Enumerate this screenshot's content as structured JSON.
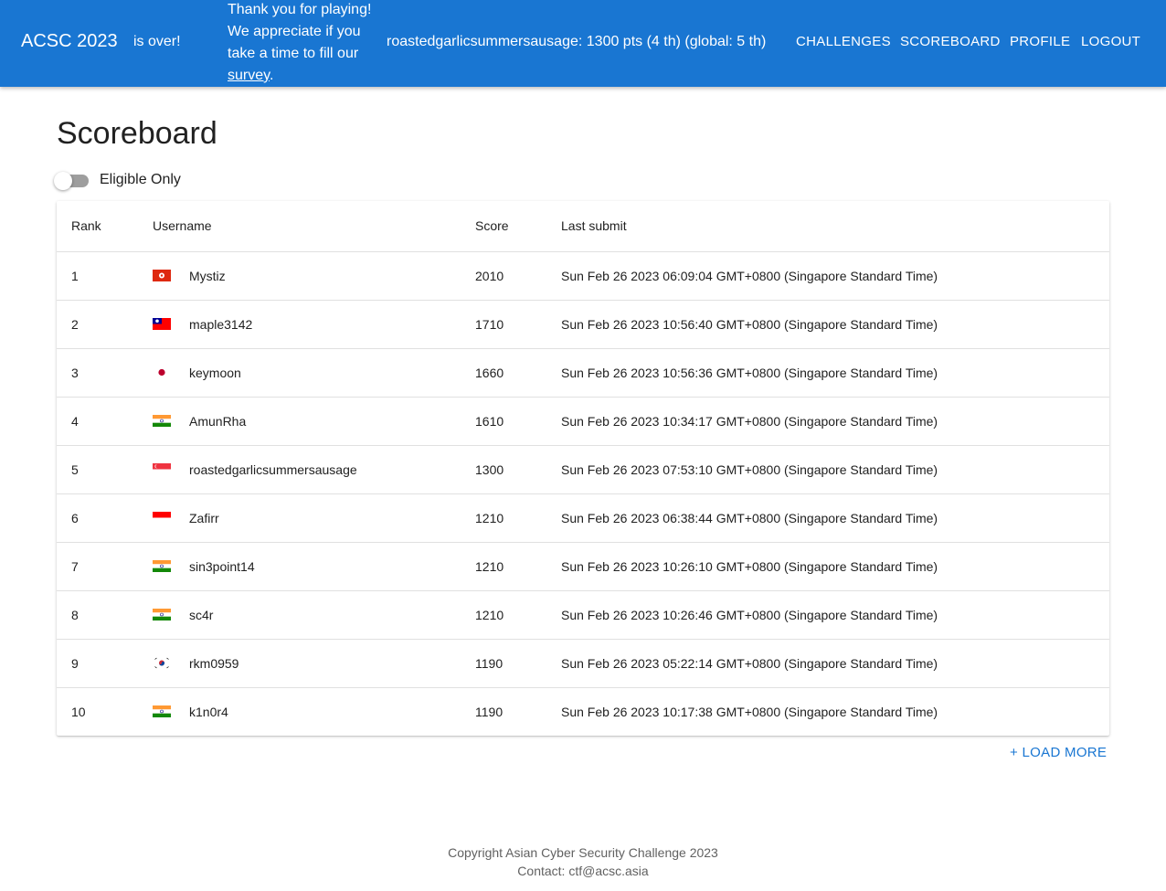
{
  "header": {
    "brand": "ACSC 2023",
    "status": "is over!",
    "thanks_text": "Thank you for playing! We appreciate if you take a time to fill our",
    "survey_link": "survey",
    "thanks_suffix": ".",
    "user_info": "roastedgarlicsummersausage: 1300 pts (4 th) (global: 5 th)",
    "nav": [
      "CHALLENGES",
      "SCOREBOARD",
      "PROFILE",
      "LOGOUT"
    ]
  },
  "page": {
    "title": "Scoreboard",
    "toggle_label": "Eligible Only",
    "toggle_on": false
  },
  "table": {
    "headers": [
      "Rank",
      "Username",
      "Score",
      "Last submit"
    ],
    "rows": [
      {
        "rank": "1",
        "flag": "hk-flag-icon",
        "username": "Mystiz",
        "score": "2010",
        "last": "Sun Feb 26 2023 06:09:04 GMT+0800 (Singapore Standard Time)"
      },
      {
        "rank": "2",
        "flag": "tw-flag-icon",
        "username": "maple3142",
        "score": "1710",
        "last": "Sun Feb 26 2023 10:56:40 GMT+0800 (Singapore Standard Time)"
      },
      {
        "rank": "3",
        "flag": "jp-flag-icon",
        "username": "keymoon",
        "score": "1660",
        "last": "Sun Feb 26 2023 10:56:36 GMT+0800 (Singapore Standard Time)"
      },
      {
        "rank": "4",
        "flag": "in-flag-icon",
        "username": "AmunRha",
        "score": "1610",
        "last": "Sun Feb 26 2023 10:34:17 GMT+0800 (Singapore Standard Time)"
      },
      {
        "rank": "5",
        "flag": "sg-flag-icon",
        "username": "roastedgarlicsummersausage",
        "score": "1300",
        "last": "Sun Feb 26 2023 07:53:10 GMT+0800 (Singapore Standard Time)"
      },
      {
        "rank": "6",
        "flag": "id-flag-icon",
        "username": "Zafirr",
        "score": "1210",
        "last": "Sun Feb 26 2023 06:38:44 GMT+0800 (Singapore Standard Time)"
      },
      {
        "rank": "7",
        "flag": "in-flag-icon",
        "username": "sin3point14",
        "score": "1210",
        "last": "Sun Feb 26 2023 10:26:10 GMT+0800 (Singapore Standard Time)"
      },
      {
        "rank": "8",
        "flag": "in-flag-icon",
        "username": "sc4r",
        "score": "1210",
        "last": "Sun Feb 26 2023 10:26:46 GMT+0800 (Singapore Standard Time)"
      },
      {
        "rank": "9",
        "flag": "kr-flag-icon",
        "username": "rkm0959",
        "score": "1190",
        "last": "Sun Feb 26 2023 05:22:14 GMT+0800 (Singapore Standard Time)"
      },
      {
        "rank": "10",
        "flag": "in-flag-icon",
        "username": "k1n0r4",
        "score": "1190",
        "last": "Sun Feb 26 2023 10:17:38 GMT+0800 (Singapore Standard Time)"
      }
    ]
  },
  "load_more": "+ LOAD MORE",
  "footer": {
    "copyright": "Copyright Asian Cyber Security Challenge 2023",
    "contact": "Contact: ctf@acsc.asia"
  },
  "colors": {
    "primary": "#1976d2",
    "text": "#212121",
    "muted": "#616161"
  }
}
